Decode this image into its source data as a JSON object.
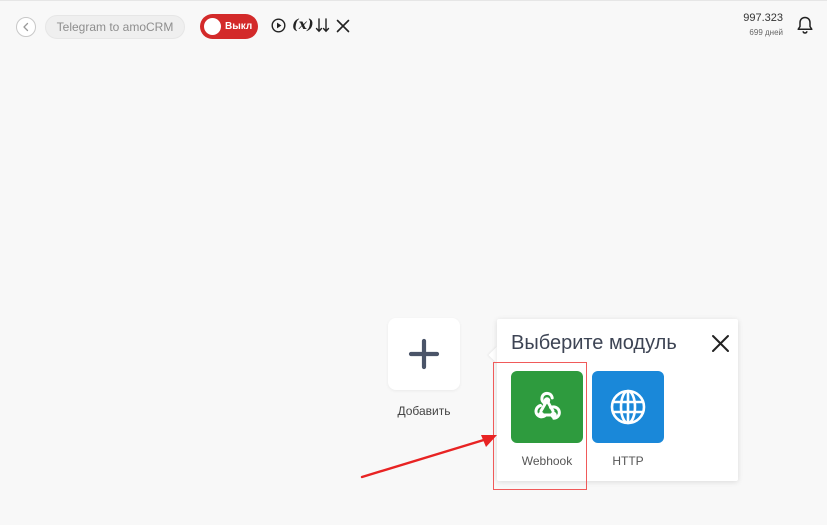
{
  "header": {
    "scenario_name": "Telegram to amoCRM",
    "toggle_label": "Выкл",
    "vars_label": "(x)",
    "credits_value": "997.323",
    "credits_days": "699 дней"
  },
  "canvas": {
    "add_label": "Добавить"
  },
  "module_picker": {
    "title": "Выберите модуль",
    "modules": [
      {
        "label": "Webhook",
        "color": "#2e9b3e",
        "icon": "webhook-icon"
      },
      {
        "label": "HTTP",
        "color": "#1a88d9",
        "icon": "globe-icon"
      }
    ]
  },
  "colors": {
    "toggle_off": "#d32a2a",
    "highlight": "#f05a5a",
    "arrow": "#e82323"
  }
}
